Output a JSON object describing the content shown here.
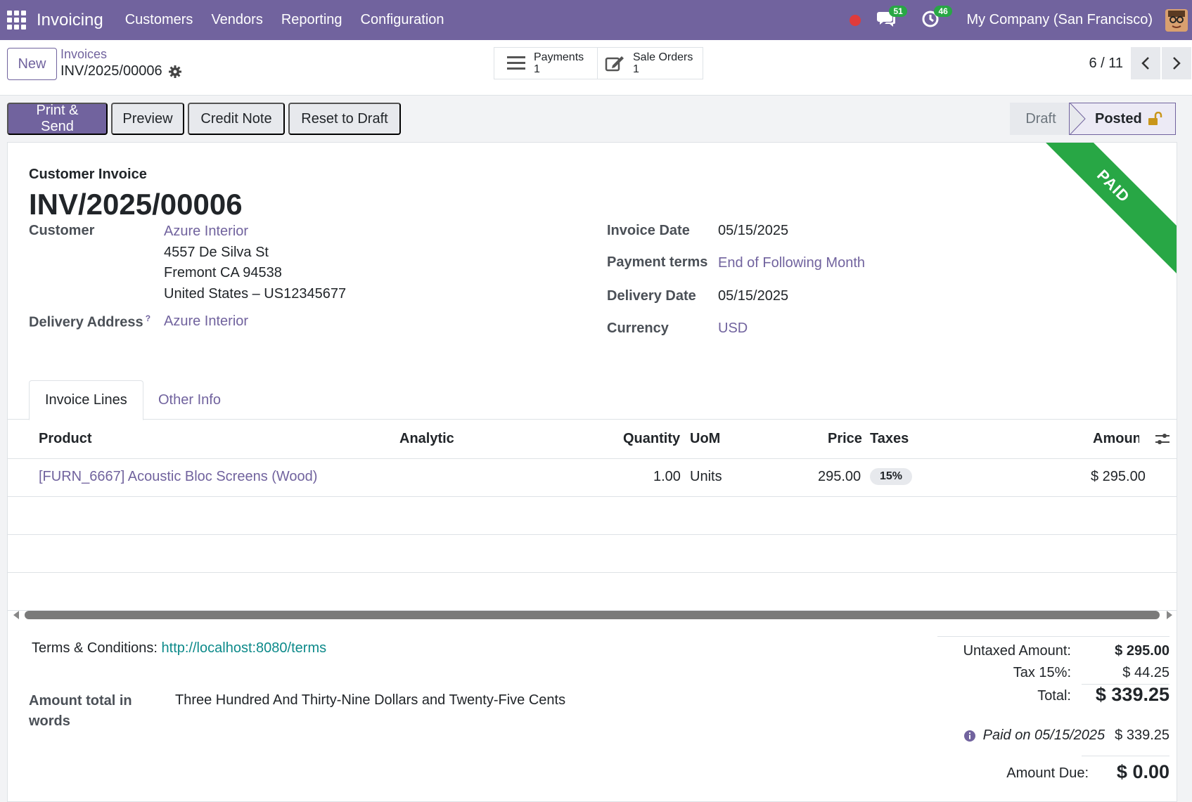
{
  "topbar": {
    "app_name": "Invoicing",
    "menu": [
      "Customers",
      "Vendors",
      "Reporting",
      "Configuration"
    ],
    "messages_count": "51",
    "activities_count": "46",
    "company": "My Company (San Francisco)"
  },
  "control": {
    "new_label": "New",
    "breadcrumb_parent": "Invoices",
    "breadcrumb_current": "INV/2025/00006",
    "payments_label": "Payments",
    "payments_count": "1",
    "sale_orders_label": "Sale Orders",
    "sale_orders_count": "1",
    "pager": "6 / 11"
  },
  "actions": {
    "print_send": "Print & Send",
    "preview": "Preview",
    "credit_note": "Credit Note",
    "reset_draft": "Reset to Draft"
  },
  "status": {
    "draft": "Draft",
    "posted": "Posted"
  },
  "invoice": {
    "ribbon": "PAID",
    "type": "Customer Invoice",
    "name": "INV/2025/00006",
    "customer_label": "Customer",
    "customer_name": "Azure Interior",
    "address_line1": "4557 De Silva St",
    "address_line2": "Fremont CA 94538",
    "address_line3": "United States – US12345677",
    "delivery_address_label": "Delivery Address",
    "delivery_address_help": "?",
    "delivery_address": "Azure Interior",
    "invoice_date_label": "Invoice Date",
    "invoice_date": "05/15/2025",
    "payment_terms_label": "Payment terms",
    "payment_terms": "End of Following Month",
    "delivery_date_label": "Delivery Date",
    "delivery_date": "05/15/2025",
    "currency_label": "Currency",
    "currency": "USD"
  },
  "tabs": {
    "invoice_lines": "Invoice Lines",
    "other_info": "Other Info"
  },
  "lines": {
    "headers": {
      "product": "Product",
      "analytic": "Analytic",
      "quantity": "Quantity",
      "uom": "UoM",
      "price": "Price",
      "taxes": "Taxes",
      "amount": "Amount"
    },
    "rows": [
      {
        "product": "[FURN_6667] Acoustic Bloc Screens (Wood)",
        "quantity": "1.00",
        "uom": "Units",
        "price": "295.00",
        "tax": "15%",
        "amount": "$ 295.00"
      }
    ]
  },
  "footer": {
    "terms_label": "Terms & Conditions:",
    "terms_link": "http://localhost:8080/terms",
    "words_label": "Amount total in words",
    "words_value": "Three Hundred And Thirty-Nine Dollars and Twenty-Five Cents"
  },
  "totals": {
    "untaxed_label": "Untaxed Amount:",
    "untaxed": "$ 295.00",
    "tax_label": "Tax 15%:",
    "tax": "$ 44.25",
    "total_label": "Total:",
    "total": "$ 339.25",
    "paid_label": "Paid on 05/15/2025",
    "paid": "$ 339.25",
    "due_label": "Amount Due:",
    "due": "$ 0.00"
  },
  "colors": {
    "brand": "#71639e",
    "paid": "#28a745"
  }
}
